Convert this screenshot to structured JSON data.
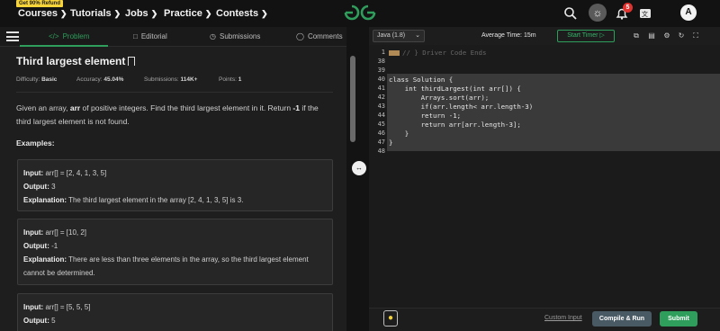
{
  "nav": {
    "promo": "Get 90% Refund",
    "items": [
      "Courses",
      "Tutorials",
      "Jobs",
      "Practice",
      "Contests"
    ],
    "notification_count": "5",
    "avatar_initial": "A",
    "logo_text": "GfG"
  },
  "tabs": [
    {
      "label": "Problem",
      "icon": "code-icon"
    },
    {
      "label": "Editorial",
      "icon": "book-icon"
    },
    {
      "label": "Submissions",
      "icon": "clock-icon"
    },
    {
      "label": "Comments",
      "icon": "comment-icon"
    }
  ],
  "problem": {
    "title": "Third largest element",
    "difficulty_label": "Difficulty:",
    "difficulty": "Basic",
    "accuracy_label": "Accuracy:",
    "accuracy": "45.04%",
    "submissions_label": "Submissions:",
    "submissions": "114K+",
    "points_label": "Points:",
    "points": "1",
    "desc_before": "Given an array, ",
    "desc_bold": "arr",
    "desc_mid": " of positive integers. Find the third largest element in it. Return ",
    "desc_bold2": "-1",
    "desc_after": " if the third largest element is not found.",
    "examples_heading": "Examples:",
    "examples": [
      {
        "input_label": "Input:",
        "input": "arr[] = [2, 4, 1, 3, 5]",
        "output_label": "Output:",
        "output": "3",
        "explanation_label": "Explanation:",
        "explanation": "The third largest element in the array [2, 4, 1, 3, 5] is 3."
      },
      {
        "input_label": "Input:",
        "input": "arr[] = [10, 2]",
        "output_label": "Output:",
        "output": "-1",
        "explanation_label": "Explanation:",
        "explanation": "There are less than three elements in the array, so the third largest element cannot be determined."
      },
      {
        "input_label": "Input:",
        "input": "arr[] = [5, 5, 5]",
        "output_label": "Output:",
        "output": "5"
      }
    ]
  },
  "editor": {
    "language": "Java (1.8)",
    "avg_time": "Average Time: 15m",
    "timer_label": "Start Timer",
    "line_numbers": [
      "1",
      "38",
      "39",
      "40",
      "41",
      "42",
      "43",
      "44",
      "45",
      "46",
      "47",
      "48"
    ],
    "code_lines": [
      "// } Driver Code Ends",
      "",
      "",
      "class Solution {",
      "    int thirdLargest(int arr[]) {",
      "        Arrays.sort(arr);",
      "        if(arr.length< arr.length-3)",
      "        return -1;",
      "        return arr[arr.length-3];",
      "    }",
      "}",
      ""
    ],
    "custom_input": "Custom Input",
    "compile_label": "Compile & Run",
    "submit_label": "Submit"
  },
  "colors": {
    "accent": "#2f9e5c",
    "background": "#131313",
    "panel": "#1e1e1e"
  }
}
